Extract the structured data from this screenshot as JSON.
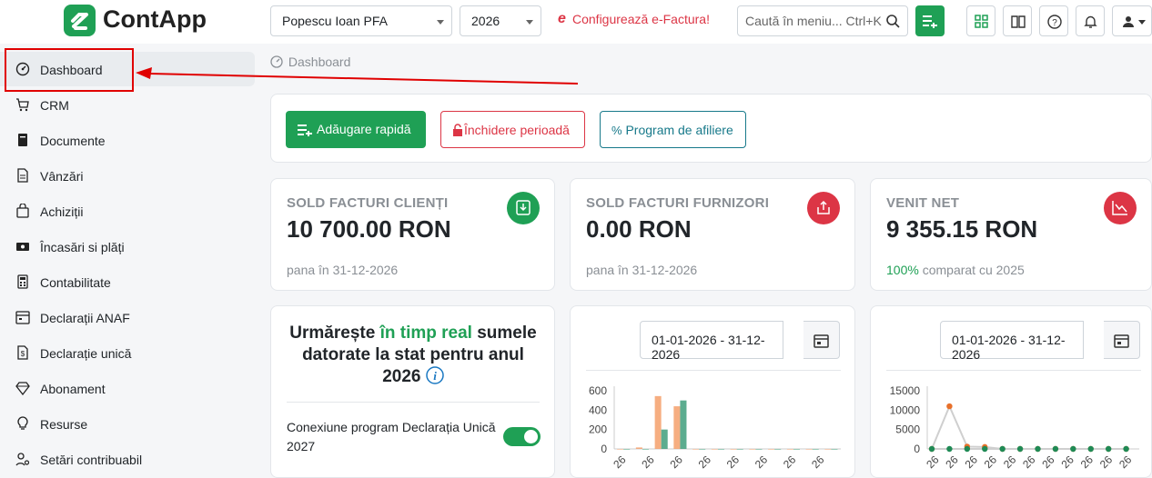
{
  "app": {
    "name": "ContApp"
  },
  "header": {
    "company": "Popescu Ioan PFA",
    "year": "2026",
    "efactura_label": "Configurează e-Factura!",
    "search_placeholder": "Caută în meniu... Ctrl+K"
  },
  "sidebar": {
    "items": [
      {
        "label": "Dashboard",
        "icon": "gauge-icon"
      },
      {
        "label": "CRM",
        "icon": "cart-icon"
      },
      {
        "label": "Documente",
        "icon": "document-icon"
      },
      {
        "label": "Vânzări",
        "icon": "file-icon"
      },
      {
        "label": "Achiziții",
        "icon": "bag-icon"
      },
      {
        "label": "Încasări si plăți",
        "icon": "cash-icon"
      },
      {
        "label": "Contabilitate",
        "icon": "calculator-icon"
      },
      {
        "label": "Declarații ANAF",
        "icon": "calendar-icon"
      },
      {
        "label": "Declarație unică",
        "icon": "file-dollar-icon"
      },
      {
        "label": "Abonament",
        "icon": "diamond-icon"
      },
      {
        "label": "Resurse",
        "icon": "bulb-icon"
      },
      {
        "label": "Setări contribuabil",
        "icon": "user-settings-icon"
      }
    ]
  },
  "breadcrumb": "Dashboard",
  "actions": {
    "quick_add": "Adăugare rapidă",
    "close_period": "Închidere perioadă",
    "affiliate": "Program de afiliere"
  },
  "stats": [
    {
      "title": "SOLD FACTURI CLIENȚI",
      "value": "10 700.00 RON",
      "sub": "pana în 31-12-2026",
      "accent": "#1fa055"
    },
    {
      "title": "SOLD FACTURI FURNIZORI",
      "value": "0.00 RON",
      "sub": "pana în 31-12-2026",
      "accent": "#dc3545"
    },
    {
      "title": "VENIT NET",
      "value": "9 355.15 RON",
      "sub_highlight": "100%",
      "sub": "comparat cu 2025",
      "accent": "#dc3545"
    }
  ],
  "tax_panel": {
    "title_pre": "Urmărește ",
    "title_hl": "în timp real",
    "title_post": " sumele datorate la stat pentru anul 2026",
    "toggle_label": "Conexiune program Declarația Unică 2027"
  },
  "date_range": "01-01-2026 - 31-12-2026",
  "chart_data": [
    {
      "type": "bar",
      "yticks": [
        "600",
        "400",
        "200",
        "0"
      ],
      "ylim": [
        0,
        600
      ],
      "series": [
        {
          "color": "#f4a06b",
          "values": [
            0,
            15,
            545,
            440,
            0,
            0,
            0,
            0,
            0,
            0,
            0,
            0
          ]
        },
        {
          "color": "#3f9e7b",
          "values": [
            0,
            0,
            200,
            500,
            0,
            0,
            0,
            0,
            0,
            0,
            0,
            0
          ]
        }
      ],
      "xticks": [
        "26",
        "26",
        "26",
        "26",
        "26",
        "26",
        "26",
        "26"
      ]
    },
    {
      "type": "line",
      "yticks": [
        "15000",
        "10000",
        "5000",
        "0"
      ],
      "ylim": [
        0,
        15000
      ],
      "series": [
        {
          "color": "#e8702a",
          "values": [
            0,
            11000,
            600,
            500,
            0,
            0,
            0,
            0,
            0,
            0,
            0,
            0
          ]
        },
        {
          "color": "#1f8a55",
          "values": [
            0,
            0,
            0,
            0,
            0,
            0,
            0,
            0,
            0,
            0,
            0,
            0
          ]
        }
      ],
      "xticks": [
        "26",
        "26",
        "26",
        "26",
        "26",
        "26",
        "26",
        "26",
        "26",
        "26",
        "26"
      ]
    }
  ]
}
